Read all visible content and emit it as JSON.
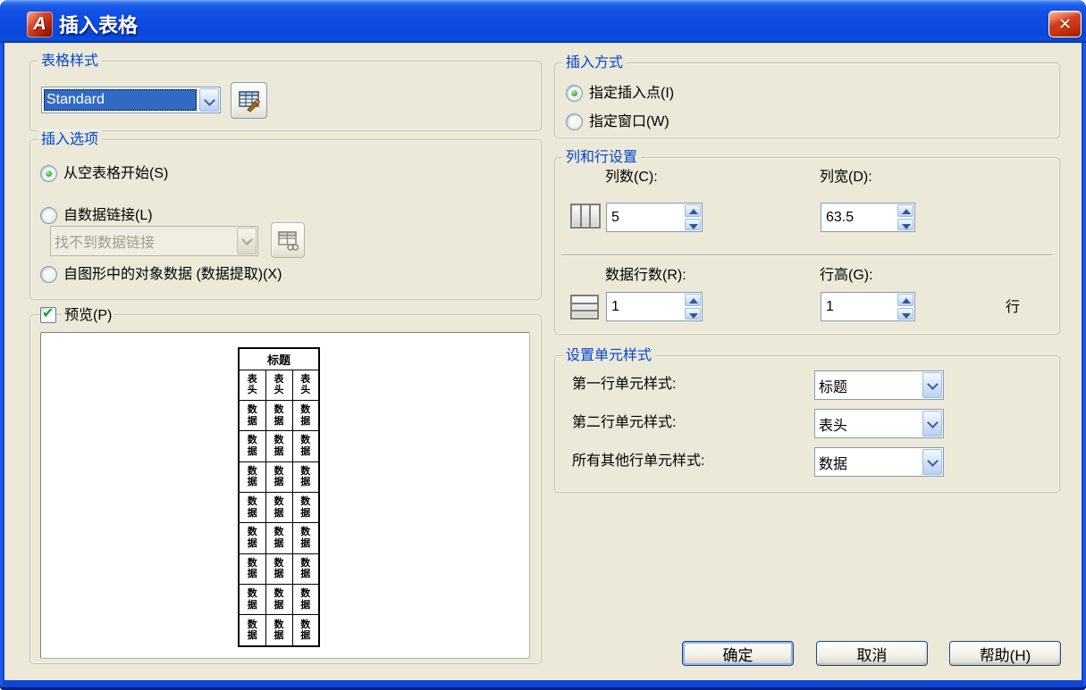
{
  "window": {
    "title": "插入表格"
  },
  "icons": {
    "app_glyph": "A",
    "close_glyph": "✕",
    "checkbox_check_glyph": "✔"
  },
  "table_style": {
    "group_label": "表格样式",
    "style_value": "Standard"
  },
  "insert_options": {
    "group_label": "插入选项",
    "radio_empty_table": "从空表格开始(S)",
    "radio_data_link": "自数据链接(L)",
    "data_link_combo_value": "找不到数据链接",
    "radio_object_data": "自图形中的对象数据  (数据提取)(X)"
  },
  "preview": {
    "checkbox_label": "预览(P)",
    "table_title": "标题",
    "header_cell": "表头",
    "data_cell": "数据",
    "columns": 3,
    "data_rows": 8
  },
  "insert_mode": {
    "group_label": "插入方式",
    "radio_insert_point": "指定插入点(I)",
    "radio_window": "指定窗口(W)"
  },
  "rows_cols": {
    "group_label": "列和行设置",
    "col_count_label": "列数(C):",
    "col_count_value": "5",
    "col_width_label": "列宽(D):",
    "col_width_value": "63.5",
    "data_rows_label": "数据行数(R):",
    "data_rows_value": "1",
    "row_height_label": "行高(G):",
    "row_height_value": "1",
    "row_height_unit": "行"
  },
  "cell_styles": {
    "group_label": "设置单元样式",
    "first_row_label": "第一行单元样式:",
    "first_row_value": "标题",
    "second_row_label": "第二行单元样式:",
    "second_row_value": "表头",
    "other_rows_label": "所有其他行单元样式:",
    "other_rows_value": "数据"
  },
  "buttons": {
    "ok": "确定",
    "cancel": "取消",
    "help": "帮助(H)"
  },
  "colors": {
    "titlebar_blue": "#0c4ae0",
    "dialog_bg": "#ece9d8",
    "group_label_blue": "#0046d5",
    "selection_blue": "#316ac5",
    "radio_dot_green": "#2aa735",
    "close_red": "#cf3a16"
  }
}
